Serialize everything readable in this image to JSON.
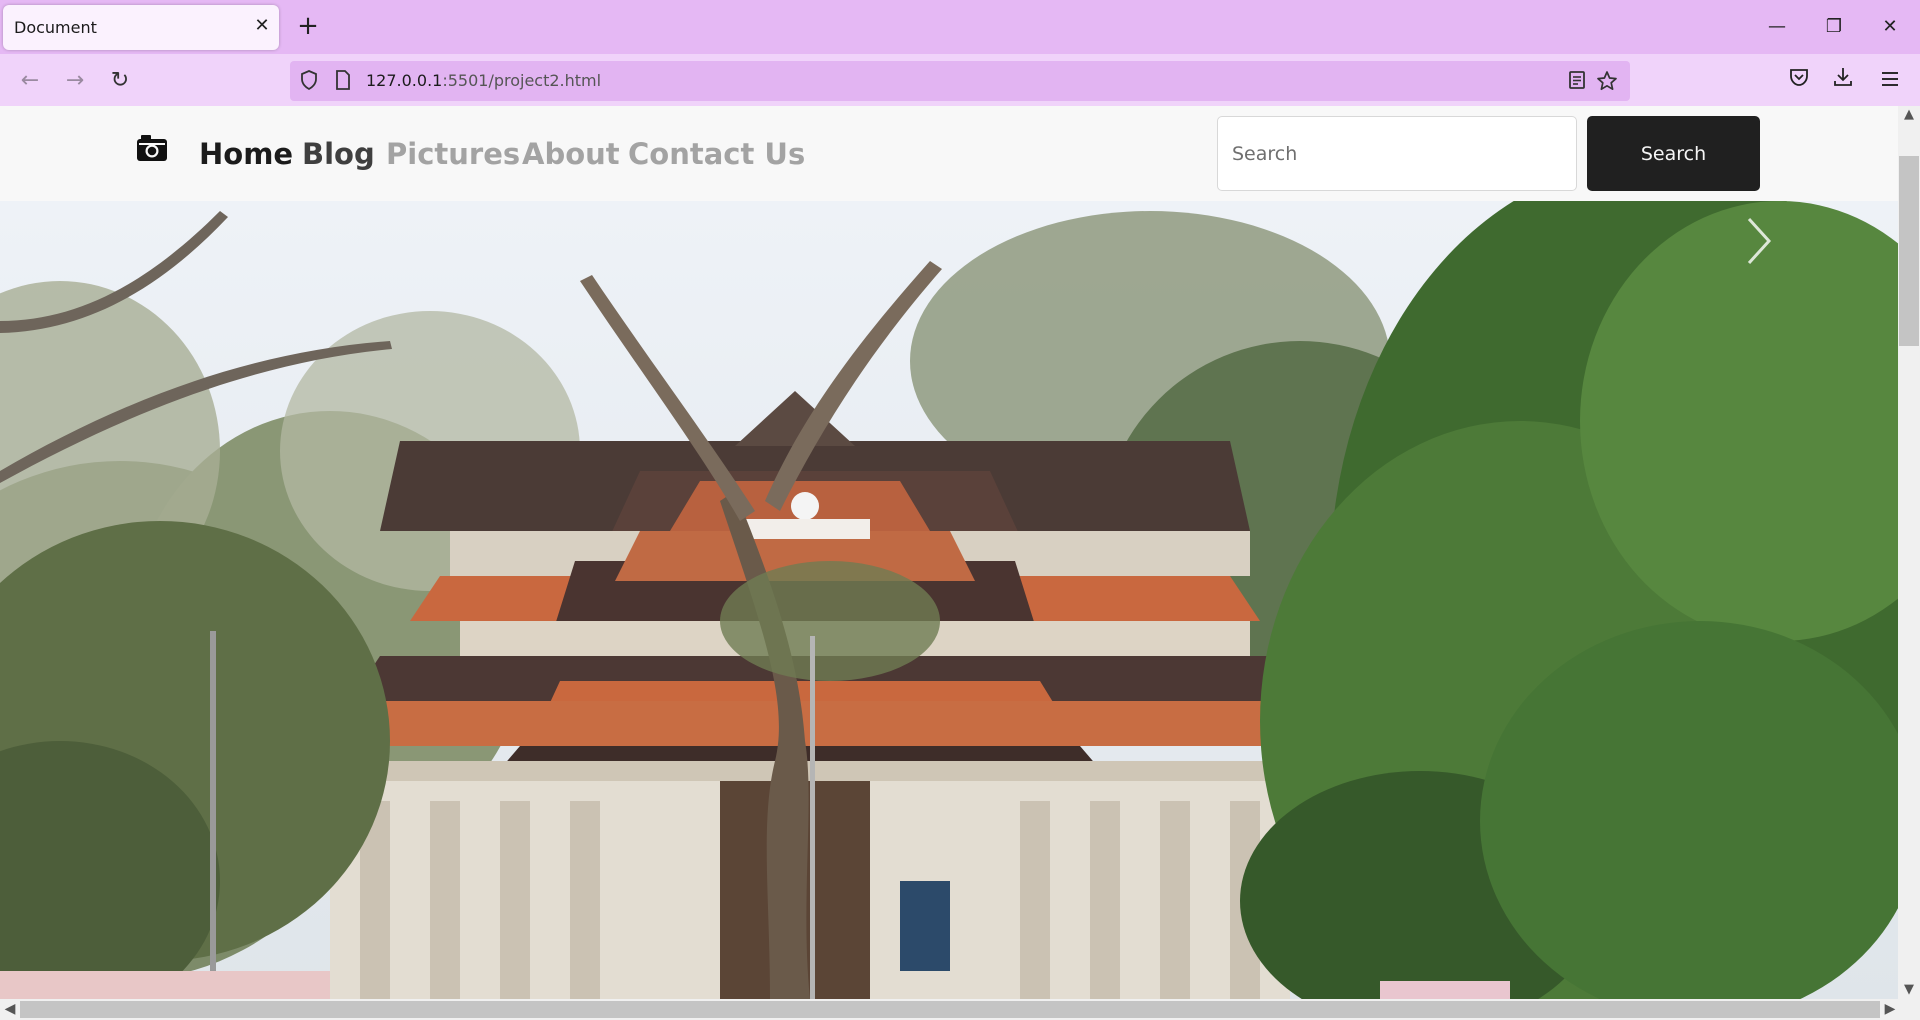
{
  "browser": {
    "tab_title": "Document",
    "tab_close": "✕",
    "new_tab": "+",
    "url_host": "127.0.0.1",
    "url_rest": ":5501/project2.html",
    "window_controls": {
      "minimize": "—",
      "restore": "❐",
      "close": "✕"
    },
    "nav": {
      "back": "←",
      "forward": "→",
      "reload": "↻"
    },
    "icons": [
      "shield-icon",
      "page-icon",
      "reader-view-icon",
      "bookmark-star-icon",
      "pocket-icon",
      "download-icon",
      "menu-icon"
    ]
  },
  "site": {
    "nav_links": [
      {
        "label": "Home",
        "state": "active"
      },
      {
        "label": "Blog",
        "state": "semi"
      },
      {
        "label": "Pictures",
        "state": "muted"
      },
      {
        "label": "About",
        "state": "muted"
      },
      {
        "label": "Contact Us",
        "state": "muted"
      }
    ],
    "search": {
      "placeholder": "Search",
      "button_label": "Search"
    },
    "carousel": {
      "next_icon": "chevron-right-icon"
    }
  },
  "colors": {
    "tabbar": "#e5b8f4",
    "toolbar": "#f0d3fa",
    "urlbar": "#e2b4f2",
    "search_button": "#202020"
  }
}
